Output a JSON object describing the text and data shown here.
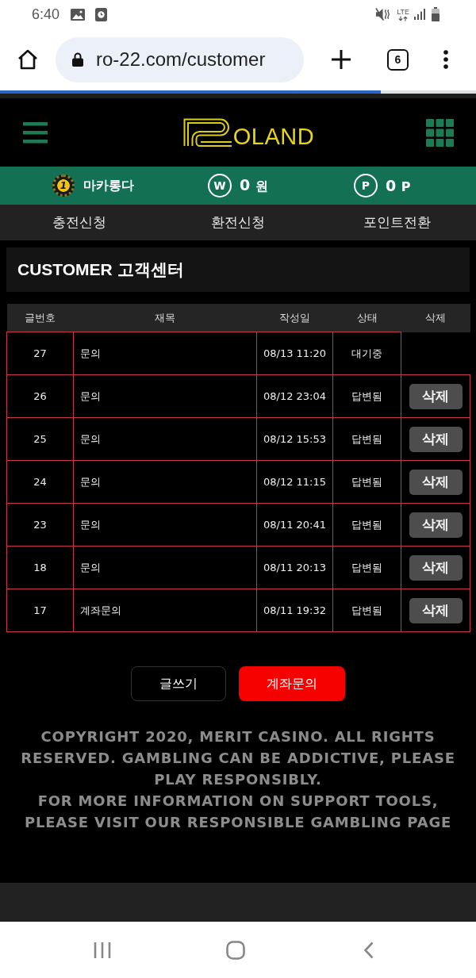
{
  "status_bar": {
    "time": "6:40",
    "network": "LTE"
  },
  "browser": {
    "url": "ro-22.com/customer",
    "tab_count": "6",
    "load_progress": {
      "level": 0.8
    }
  },
  "site_header": {
    "logo_text": "OLAND"
  },
  "account_bar": {
    "level_badge": "1",
    "username": "마카롱다",
    "balance": {
      "symbol": "W",
      "amount": "0",
      "unit": "원"
    },
    "points": {
      "symbol": "P",
      "amount": "0",
      "unit": "P"
    }
  },
  "nav": [
    "충전신청",
    "환전신청",
    "포인트전환"
  ],
  "page_title": "CUSTOMER 고객센터",
  "table": {
    "columns": [
      "글번호",
      "재목",
      "작성일",
      "상태",
      "삭제"
    ],
    "rows": [
      {
        "number": "27",
        "title": "문의",
        "date": "08/13 11:20",
        "status": "대기중"
      },
      {
        "number": "26",
        "title": "문의",
        "date": "08/12 23:04",
        "status": "답변됨",
        "delete_button": "삭제"
      },
      {
        "number": "25",
        "title": "문의",
        "date": "08/12 15:53",
        "status": "답변됨",
        "delete_button": "삭제"
      },
      {
        "number": "24",
        "title": "문의",
        "date": "08/12 11:15",
        "status": "답변됨",
        "delete_button": "삭제"
      },
      {
        "number": "23",
        "title": "문의",
        "date": "08/11 20:41",
        "status": "답변됨",
        "delete_button": "삭제"
      },
      {
        "number": "18",
        "title": "문의",
        "date": "08/11 20:13",
        "status": "답변됨",
        "delete_button": "삭제"
      },
      {
        "number": "17",
        "title": "계좌문의",
        "date": "08/11 19:32",
        "status": "답변됨",
        "delete_button": "삭제"
      }
    ]
  },
  "actions": [
    {
      "label": "글쓰기",
      "kind": "outline"
    },
    {
      "label": "계좌문의",
      "kind": "primary"
    }
  ],
  "footer": [
    "COPYRIGHT 2020, MERIT CASINO. ALL RIGHTS RESERVED. GAMBLING CAN BE ADDICTIVE, PLEASE PLAY RESPONSIBLY.",
    "FOR MORE INFORMATION ON SUPPORT TOOLS, PLEASE VISIT OUR RESPONSIBLE GAMBLING PAGE"
  ]
}
